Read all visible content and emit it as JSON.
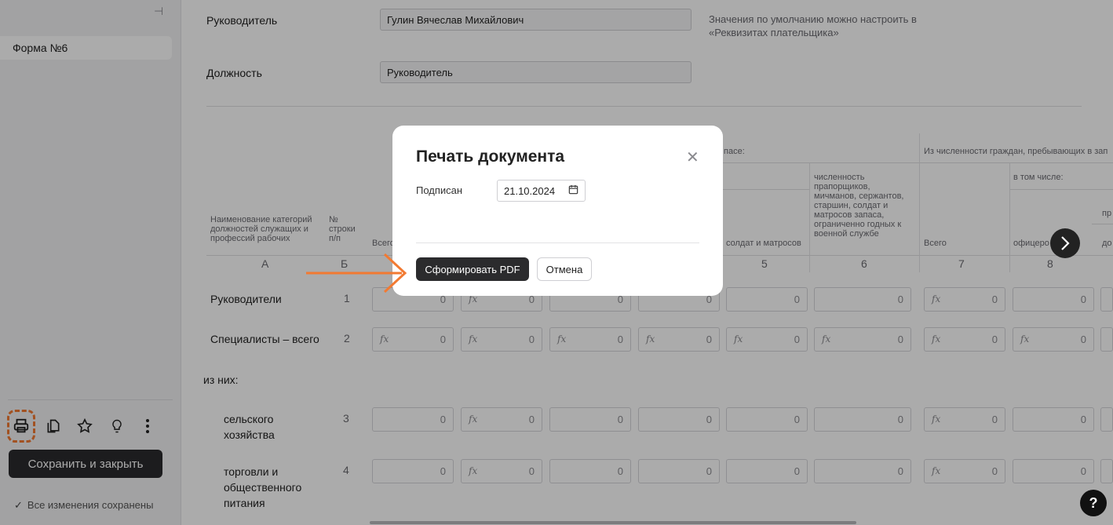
{
  "sidebar": {
    "form_item": "Форма №6",
    "tools": [
      "print-icon",
      "copy-icon",
      "star-icon",
      "lightbulb-icon",
      "more-vertical-icon"
    ],
    "save_close": "Сохранить и закрыть",
    "saved_status": "Все изменения сохранены"
  },
  "form": {
    "head_label": "Руководитель",
    "head_value": "Гулин Вячеслав Михайлович",
    "hint": "Значения по умолчанию можно настроить в «Реквизитах плательщика»",
    "position_label": "Должность",
    "position_value": "Руководитель"
  },
  "table": {
    "headers": {
      "name": "Наименование категорий должностей служащих и профессий рабочих",
      "num": "№ строки п/п",
      "total": "Всего",
      "reserve_frag": "пасе:",
      "soldiers": "солдат и матросов",
      "limited": "численность прапорщиков, мичманов, сержантов, старшин, солдат и матросов запаса, ограниченно годных к военной службе",
      "from_count": "Из численности граждан, пребывающих в зап",
      "incl": "в том числе:",
      "pr": "пр",
      "total2": "Всего",
      "officers": "офицеро",
      "do": "до"
    },
    "col_letters": [
      "А",
      "Б",
      "5",
      "6",
      "7",
      "8"
    ],
    "rows": [
      {
        "label": "Руководители",
        "num": "1"
      },
      {
        "label": "Специалисты – всего",
        "num": "2"
      },
      {
        "label": "из них:",
        "num": ""
      },
      {
        "label": "сельского хозяйства",
        "num": "3"
      },
      {
        "label": "торговли и общественного питания",
        "num": "4"
      }
    ],
    "cell_value": "0",
    "fx_label": "fx"
  },
  "modal": {
    "title": "Печать документа",
    "close_icon": "close-icon",
    "signed_label": "Подписан",
    "signed_date": "21.10.2024",
    "pdf_button": "Сформировать PDF",
    "cancel_button": "Отмена"
  },
  "colors": {
    "accent": "#f27a32",
    "dark": "#2b2b2d"
  },
  "help": "?"
}
